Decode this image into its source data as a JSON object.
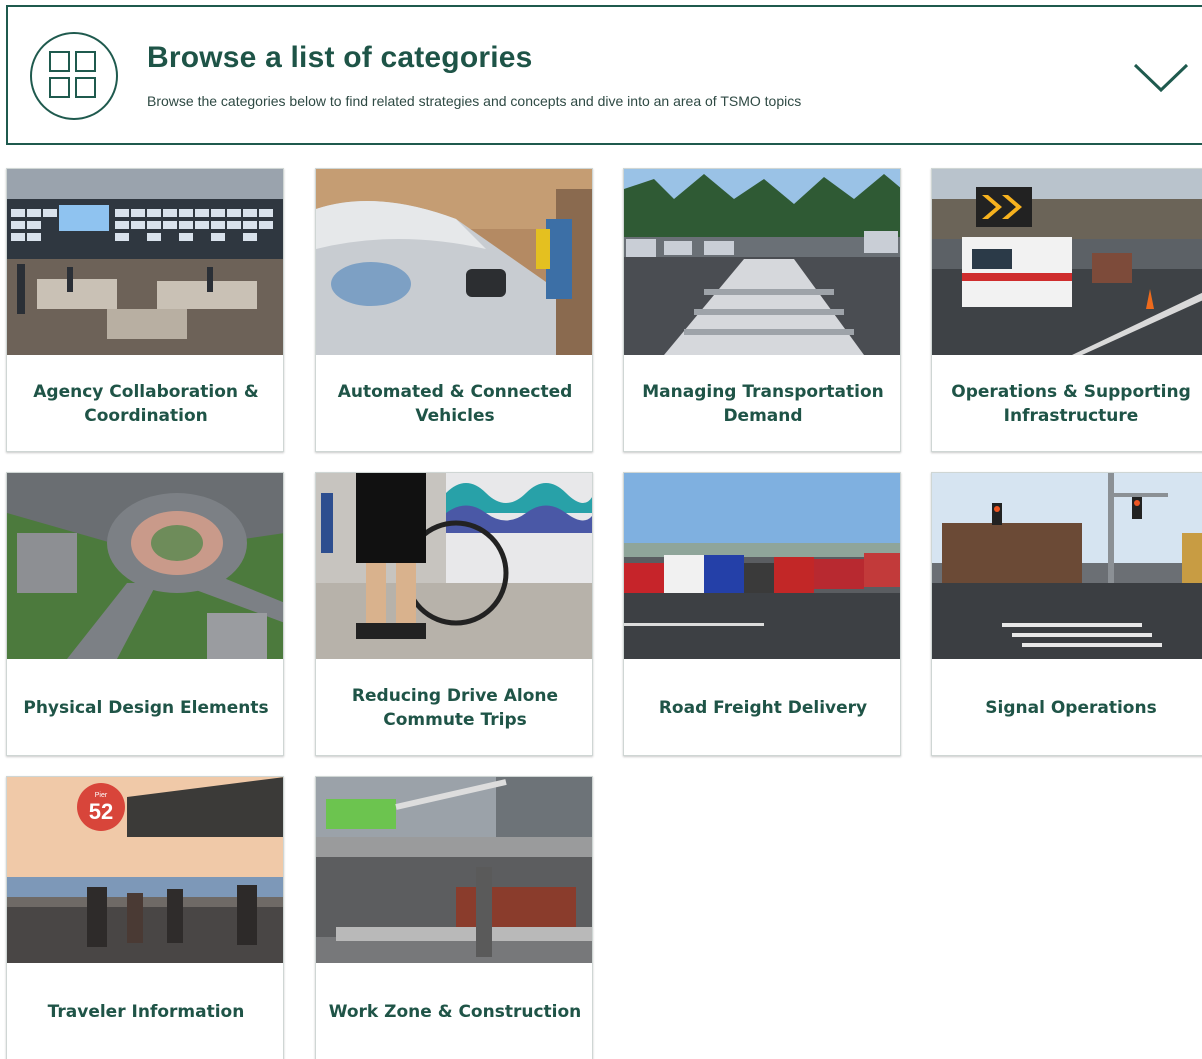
{
  "header": {
    "title": "Browse a list of categories",
    "subtitle": "Browse the categories below to find related strategies and concepts and dive into an area of TSMO topics"
  },
  "categories": [
    {
      "label": "Agency Collaboration & Coordination",
      "photo": "traffic-operations-center"
    },
    {
      "label": "Automated & Connected Vehicles",
      "photo": "electric-car-charging"
    },
    {
      "label": "Managing Transportation Demand",
      "photo": "park-and-ride-crosswalk"
    },
    {
      "label": "Operations & Supporting Infrastructure",
      "photo": "incident-response-truck"
    },
    {
      "label": "Physical Design Elements",
      "photo": "roundabout-aerial"
    },
    {
      "label": "Reducing Drive Alone Commute Trips",
      "photo": "bicycle-on-bus"
    },
    {
      "label": "Road Freight Delivery",
      "photo": "truck-parking"
    },
    {
      "label": "Signal Operations",
      "photo": "signalized-intersection"
    },
    {
      "label": "Traveler Information",
      "photo": "ferry-terminal-pier"
    },
    {
      "label": "Work Zone & Construction",
      "photo": "viaduct-demolition"
    }
  ],
  "photo_text": {
    "pier_sign_top": "Pier",
    "pier_sign_number": "52"
  },
  "colors": {
    "brand": "#1f5a4e",
    "title": "#1e5447",
    "card_border": "#cfd6d4"
  },
  "icons": {
    "header_icon": "grid-icon",
    "toggle_icon": "chevron-down-icon"
  }
}
